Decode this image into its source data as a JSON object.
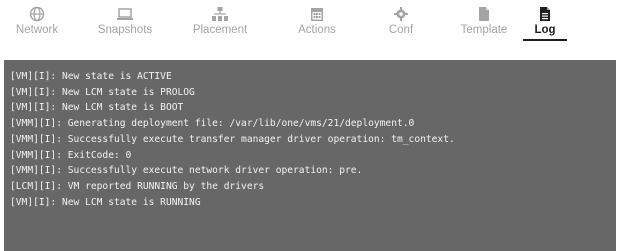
{
  "tabs": [
    {
      "label": "Network",
      "icon": "network-icon",
      "active": false
    },
    {
      "label": "Snapshots",
      "icon": "laptop-icon",
      "active": false
    },
    {
      "label": "Placement",
      "icon": "sitemap-icon",
      "active": false
    },
    {
      "label": "Actions",
      "icon": "calendar-icon",
      "active": false
    },
    {
      "label": "Conf",
      "icon": "gear-icon",
      "active": false
    },
    {
      "label": "Template",
      "icon": "file-icon",
      "active": false
    },
    {
      "label": "Log",
      "icon": "file-text-icon",
      "active": true
    }
  ],
  "colors": {
    "console_bg": "#676767",
    "console_text": "#f2f2f2",
    "tab_inactive": "#a4a4a4",
    "tab_active": "#1f1f1f"
  },
  "log": {
    "lines": [
      "[VM][I]: New state is ACTIVE",
      "[VM][I]: New LCM state is PROLOG",
      "[VM][I]: New LCM state is BOOT",
      "[VMM][I]: Generating deployment file: /var/lib/one/vms/21/deployment.0",
      "[VMM][I]: Successfully execute transfer manager driver operation: tm_context.",
      "[VMM][I]: ExitCode: 0",
      "[VMM][I]: Successfully execute network driver operation: pre.",
      "[LCM][I]: VM reported RUNNING by the drivers",
      "[VM][I]: New LCM state is RUNNING"
    ]
  }
}
